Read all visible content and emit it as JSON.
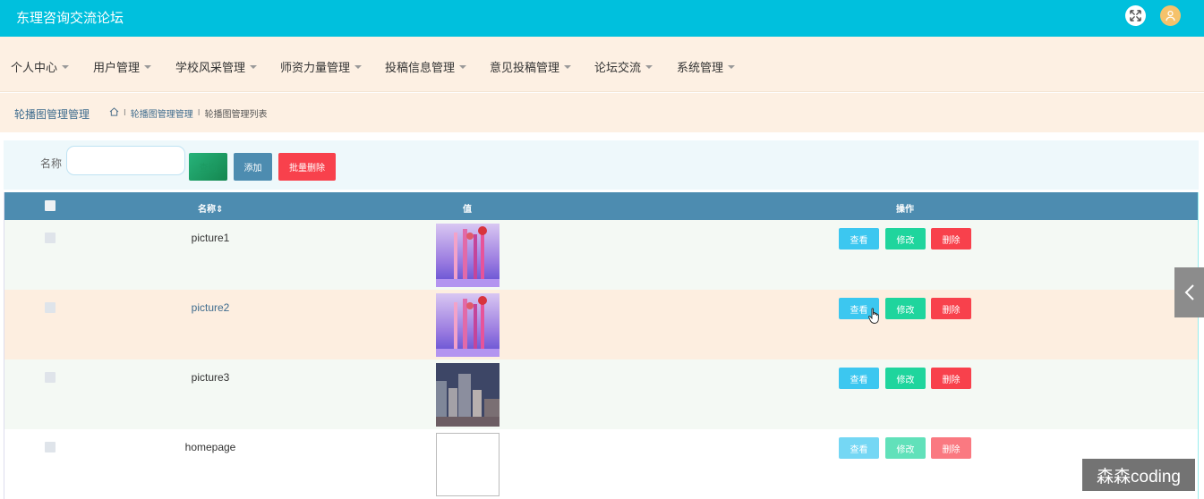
{
  "app": {
    "title": "东理咨询交流论坛"
  },
  "nav": {
    "items": [
      {
        "label": "个人中心"
      },
      {
        "label": "用户管理"
      },
      {
        "label": "学校风采管理"
      },
      {
        "label": "师资力量管理"
      },
      {
        "label": "投稿信息管理"
      },
      {
        "label": "意见投稿管理"
      },
      {
        "label": "论坛交流"
      },
      {
        "label": "系统管理"
      }
    ]
  },
  "page": {
    "title": "轮播图管理管理",
    "breadcrumb": [
      "轮播图管理管理",
      "轮播图管理列表"
    ],
    "breadcrumb_sep": "I"
  },
  "search": {
    "label": "名称",
    "value": "",
    "search_button": "查询",
    "add_button": "添加",
    "batch_delete_button": "批量删除"
  },
  "table": {
    "columns": {
      "name": "名称",
      "value": "值",
      "actions": "操作"
    },
    "action_labels": {
      "view": "查看",
      "edit": "修改",
      "delete": "删除"
    },
    "rows": [
      {
        "name": "picture1",
        "image": "flowers-purple"
      },
      {
        "name": "picture2",
        "image": "flowers-purple"
      },
      {
        "name": "picture3",
        "image": "city-buildings"
      },
      {
        "name": "homepage",
        "image": "broken-image"
      }
    ]
  },
  "watermark": "森森coding",
  "colors": {
    "topbar": "#00c0dd",
    "nav_bg": "#fdf0e3",
    "table_header": "#4d8cb0",
    "view": "#3cc7f0",
    "edit": "#1fd59d",
    "delete": "#f8414c"
  }
}
